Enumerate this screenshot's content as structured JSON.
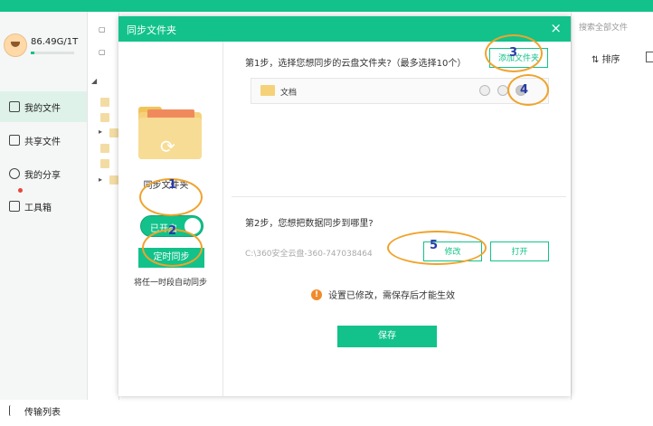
{
  "sidebar": {
    "storage": "86.49G/1T",
    "storage_used_fraction": 0.09,
    "items": [
      {
        "label": "我的文件"
      },
      {
        "label": "共享文件"
      },
      {
        "label": "我的分享"
      },
      {
        "label": "工具箱"
      },
      {
        "label": "传输列表"
      }
    ]
  },
  "toolbar": {
    "search_placeholder": "搜索全部文件",
    "sort_label": "排序"
  },
  "dialog": {
    "title": "同步文件夹",
    "close_glyph": "×",
    "left": {
      "folder_label": "同步文件夹",
      "toggle_label": "已开启",
      "timed_sync_label": "定时同步",
      "timed_sync_desc": "将任一时段自动同步"
    },
    "step1": {
      "text": "第1步，选择您想同步的云盘文件夹?（最多选择10个）",
      "add_button": "添加文件夹",
      "folders": [
        {
          "name": "文档"
        }
      ]
    },
    "step2": {
      "text": "第2步，您想把数据同步到哪里?",
      "path": "C:\\360安全云盘-360-747038464",
      "modify_button": "修改",
      "open_button": "打开"
    },
    "warning": "设置已修改，需保存后才能生效",
    "save_button": "保存"
  },
  "annotations": [
    "1",
    "2",
    "3",
    "4",
    "5"
  ],
  "colors": {
    "accent": "#12c28a",
    "marker": "#f0a32c",
    "marker_text": "#2a3aa8"
  }
}
